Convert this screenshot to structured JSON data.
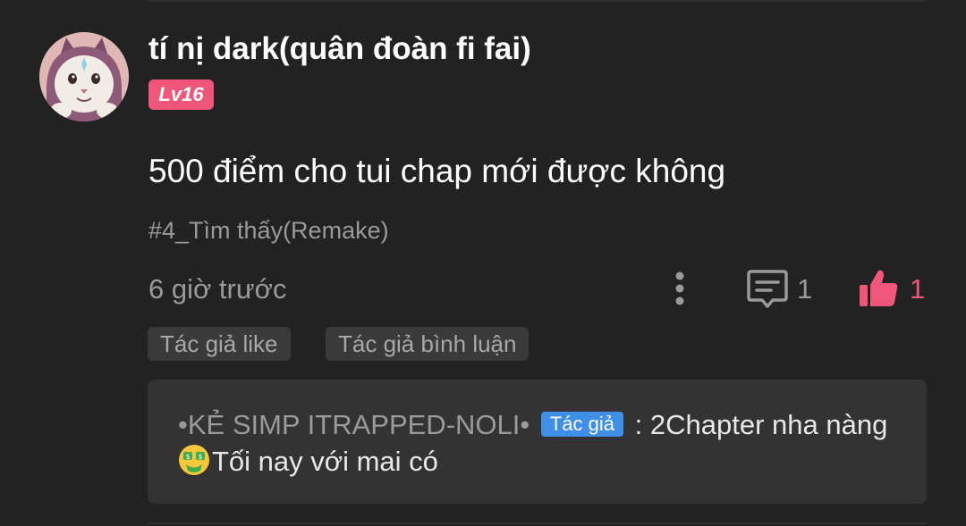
{
  "comment": {
    "username": "tí nị dark(quân đoàn fi fai)",
    "level": "Lv16",
    "text": "500 điểm cho tui chap mới được không",
    "chapter_tag": "#4_Tìm thấy(Remake)",
    "time_ago": "6 giờ trước",
    "reply_count": "1",
    "like_count": "1",
    "icons": {
      "avatar": "cat-avatar",
      "more": "more-vertical-icon",
      "reply": "comment-icon",
      "like": "thumbs-up-icon"
    }
  },
  "chips": {
    "author_like": "Tác giả like",
    "author_comment": "Tác giả bình luận"
  },
  "reply": {
    "author": "•KẺ SIMP ITRAPPED-NOLI•",
    "author_badge": "Tác giả",
    "separator": ":",
    "message_line1": "2Chapter nha nàng",
    "message_line2": "Tối nay với mai có",
    "emoji": "money-mouth-face"
  },
  "colors": {
    "background": "#222222",
    "accent_pink": "#f0567a",
    "author_blue": "#3f8fe8",
    "muted_text": "#9a9a9a",
    "reply_box": "#333333"
  }
}
